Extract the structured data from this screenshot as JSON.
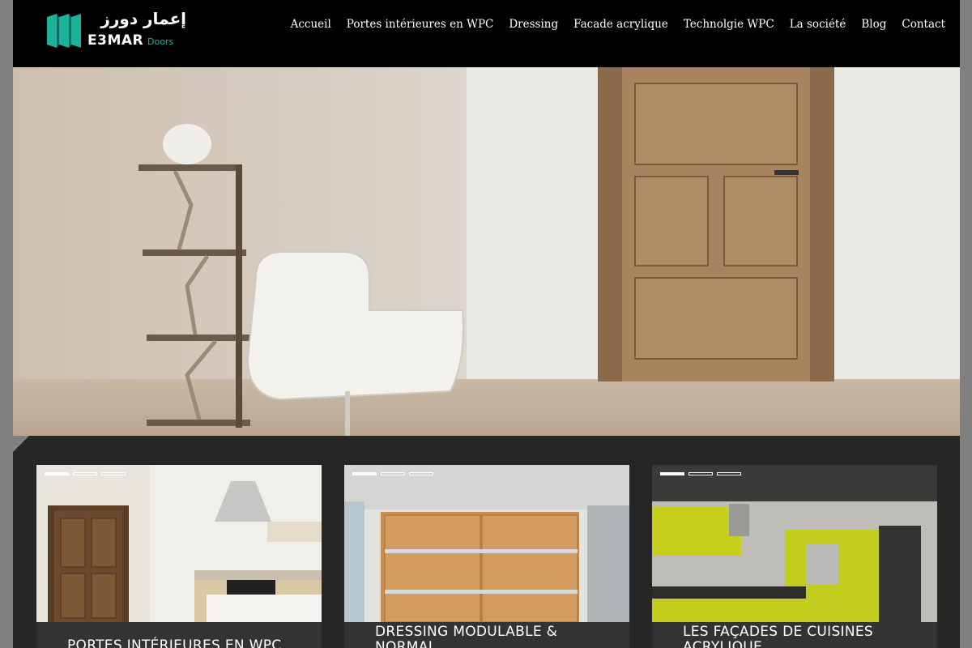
{
  "header": {
    "logo": {
      "arabic": "إعمار دورز",
      "word": "E3MAR",
      "sub": "Doors",
      "accent_color": "#1fb29a"
    },
    "nav": [
      {
        "label": "Accueil"
      },
      {
        "label": "Portes intérieures en WPC"
      },
      {
        "label": "Dressing"
      },
      {
        "label": "Facade acrylique"
      },
      {
        "label": "Technolgie WPC"
      },
      {
        "label": "La société"
      },
      {
        "label": "Blog"
      },
      {
        "label": "Contact"
      }
    ]
  },
  "cards": [
    {
      "title": "PORTES INTÉRIEURES EN WPC",
      "active_slide": 1,
      "slides": 3
    },
    {
      "title": "DRESSING MODULABLE & NORMAL",
      "active_slide": 1,
      "slides": 3
    },
    {
      "title": "LES FAÇADES DE CUISINES ACRYLIQUE",
      "active_slide": 1,
      "slides": 3
    }
  ]
}
